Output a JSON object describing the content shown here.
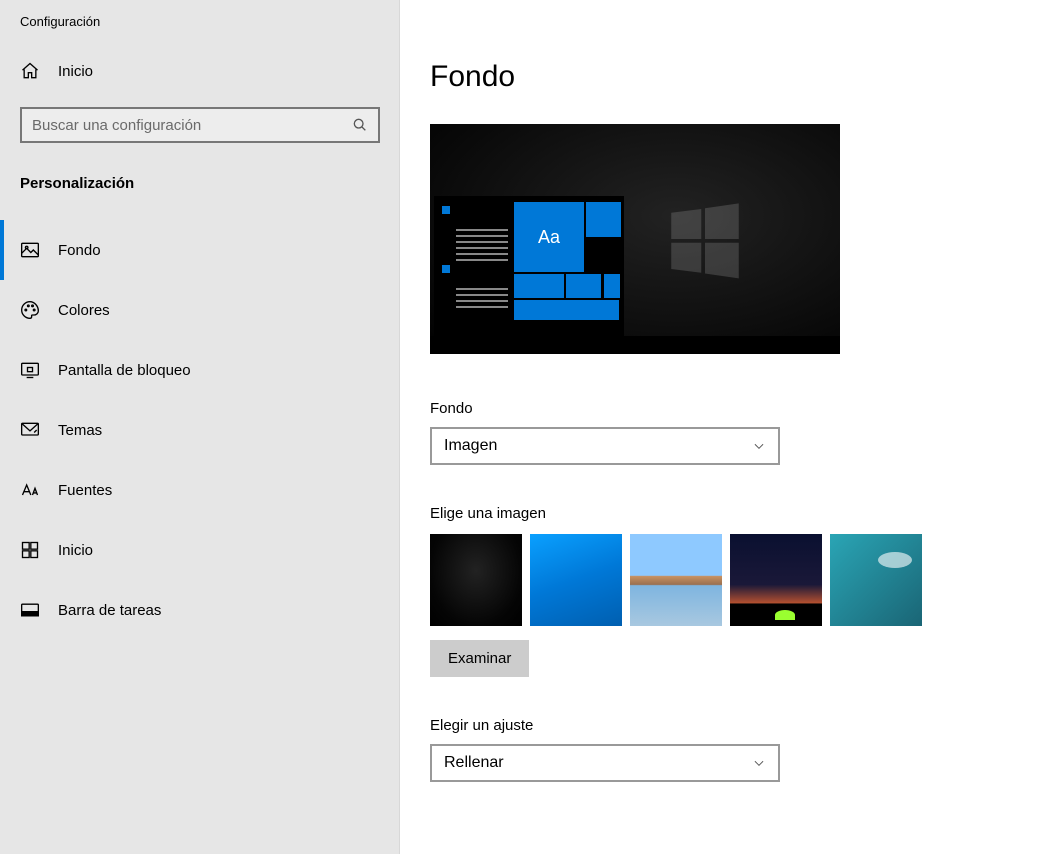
{
  "appTitle": "Configuración",
  "home": {
    "label": "Inicio"
  },
  "search": {
    "placeholder": "Buscar una configuración"
  },
  "sectionTitle": "Personalización",
  "nav": [
    {
      "label": "Fondo",
      "key": "fondo"
    },
    {
      "label": "Colores",
      "key": "colores"
    },
    {
      "label": "Pantalla de bloqueo",
      "key": "bloqueo"
    },
    {
      "label": "Temas",
      "key": "temas"
    },
    {
      "label": "Fuentes",
      "key": "fuentes"
    },
    {
      "label": "Inicio",
      "key": "inicio"
    },
    {
      "label": "Barra de tareas",
      "key": "barra"
    }
  ],
  "page": {
    "title": "Fondo",
    "previewText": "Aa",
    "bgTypeLabel": "Fondo",
    "bgTypeValue": "Imagen",
    "chooseImageLabel": "Elige una imagen",
    "browseLabel": "Examinar",
    "fitLabel": "Elegir un ajuste",
    "fitValue": "Rellenar"
  }
}
